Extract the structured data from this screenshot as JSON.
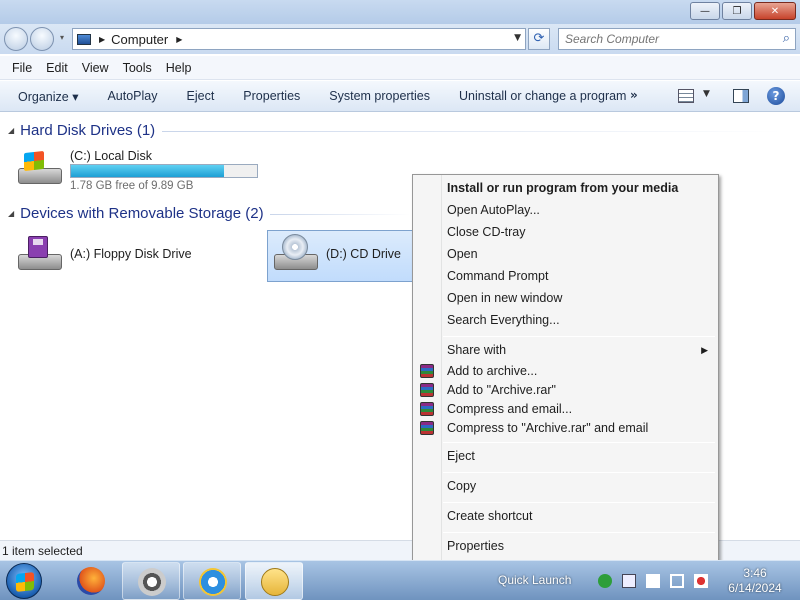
{
  "window": {
    "minimize_glyph": "—",
    "maximize_glyph": "❐",
    "close_glyph": "✕"
  },
  "address": {
    "crumb": "Computer",
    "search_placeholder": "Search Computer"
  },
  "menubar": [
    "File",
    "Edit",
    "View",
    "Tools",
    "Help"
  ],
  "toolbar": {
    "organize": "Organize ▾",
    "autoplay": "AutoPlay",
    "eject": "Eject",
    "properties": "Properties",
    "system_properties": "System properties",
    "uninstall": "Uninstall or change a program",
    "more": "»"
  },
  "groups": {
    "hdd": "Hard Disk Drives (1)",
    "removable": "Devices with Removable Storage (2)"
  },
  "drives": {
    "c": {
      "label": "(C:) Local Disk",
      "free_text": "1.78 GB free of 9.89 GB",
      "used_fraction": 0.82
    },
    "a": {
      "label": "(A:) Floppy Disk Drive"
    },
    "d": {
      "label": "(D:) CD Drive"
    }
  },
  "status": {
    "text": "1 item selected"
  },
  "context_menu": {
    "items": [
      "Install or run program from your media",
      "Open AutoPlay...",
      "Close CD-tray",
      "Open",
      "Command Prompt",
      "Open in new window",
      "Search Everything...",
      "Share with",
      "Add to archive...",
      "Add to \"Archive.rar\"",
      "Compress and email...",
      "Compress to \"Archive.rar\" and email",
      "Eject",
      "Copy",
      "Create shortcut",
      "Properties"
    ]
  },
  "taskbar": {
    "quick_launch": "Quick Launch",
    "time": "3:46",
    "date": "6/14/2024"
  },
  "icons": [
    "back-icon",
    "forward-icon",
    "computer-icon",
    "refresh-icon",
    "search-icon",
    "views-icon",
    "preview-pane-icon",
    "help-icon",
    "hdd-icon",
    "floppy-icon",
    "cd-drive-icon",
    "winrar-icon",
    "start-orb-icon",
    "firefox-icon",
    "raccoon-icon",
    "ie-icon",
    "folder-icon"
  ],
  "colors": {
    "group_title": "#1e3287",
    "capacity_bar": "#1d9fd4",
    "selection": "#c1dcfc"
  }
}
